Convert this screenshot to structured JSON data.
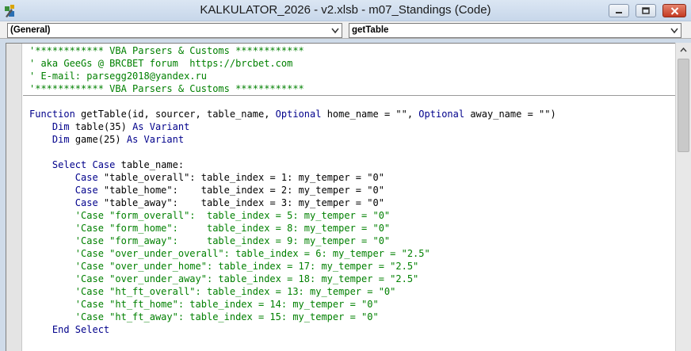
{
  "window": {
    "title": "KALKULATOR_2026 - v2.xlsb - m07_Standings (Code)",
    "icon": "vba-module-icon",
    "buttons": [
      "minimize-icon",
      "maximize-icon",
      "close-icon"
    ]
  },
  "combos": {
    "object": "(General)",
    "procedure": "getTable"
  },
  "code": {
    "header": [
      "'************ VBA Parsers & Customs ************",
      "' aka GeeGs @ BRCBET forum  https://brcbet.com",
      "' E-mail: parsegg2018@yandex.ru",
      "'************ VBA Parsers & Customs ************"
    ],
    "lines": [
      {
        "kw1": "Function",
        "t1": " getTable(id, sourcer, table_name, ",
        "kw2": "Optional",
        "t2": " home_name = \"\", ",
        "kw3": "Optional",
        "t3": " away_name = \"\")"
      },
      {
        "indent": "    ",
        "kw1": "Dim",
        "t1": " table(35) ",
        "kw2": "As Variant"
      },
      {
        "indent": "    ",
        "kw1": "Dim",
        "t1": " game(25) ",
        "kw2": "As Variant"
      },
      {
        "indent": "    ",
        "kw1": "Select Case",
        "t1": " table_name:"
      },
      {
        "indent": "        ",
        "kw1": "Case",
        "t1": " \"table_overall\": table_index = 1: my_temper = \"0\""
      },
      {
        "indent": "        ",
        "kw1": "Case",
        "t1": " \"table_home\":    table_index = 2: my_temper = \"0\""
      },
      {
        "indent": "        ",
        "kw1": "Case",
        "t1": " \"table_away\":    table_index = 3: my_temper = \"0\""
      },
      {
        "indent": "        ",
        "comment": "'Case \"form_overall\":  table_index = 5: my_temper = \"0\""
      },
      {
        "indent": "        ",
        "comment": "'Case \"form_home\":     table_index = 8: my_temper = \"0\""
      },
      {
        "indent": "        ",
        "comment": "'Case \"form_away\":     table_index = 9: my_temper = \"0\""
      },
      {
        "indent": "        ",
        "comment": "'Case \"over_under_overall\": table_index = 6: my_temper = \"2.5\""
      },
      {
        "indent": "        ",
        "comment": "'Case \"over_under_home\": table_index = 17: my_temper = \"2.5\""
      },
      {
        "indent": "        ",
        "comment": "'Case \"over_under_away\": table_index = 18: my_temper = \"2.5\""
      },
      {
        "indent": "        ",
        "comment": "'Case \"ht_ft_overall\": table_index = 13: my_temper = \"0\""
      },
      {
        "indent": "        ",
        "comment": "'Case \"ht_ft_home\": table_index = 14: my_temper = \"0\""
      },
      {
        "indent": "        ",
        "comment": "'Case \"ht_ft_away\": table_index = 15: my_temper = \"0\""
      },
      {
        "indent": "    ",
        "kw1": "End Select"
      }
    ]
  },
  "colors": {
    "comment": "#008000",
    "keyword": "#00008b",
    "text": "#000000"
  }
}
